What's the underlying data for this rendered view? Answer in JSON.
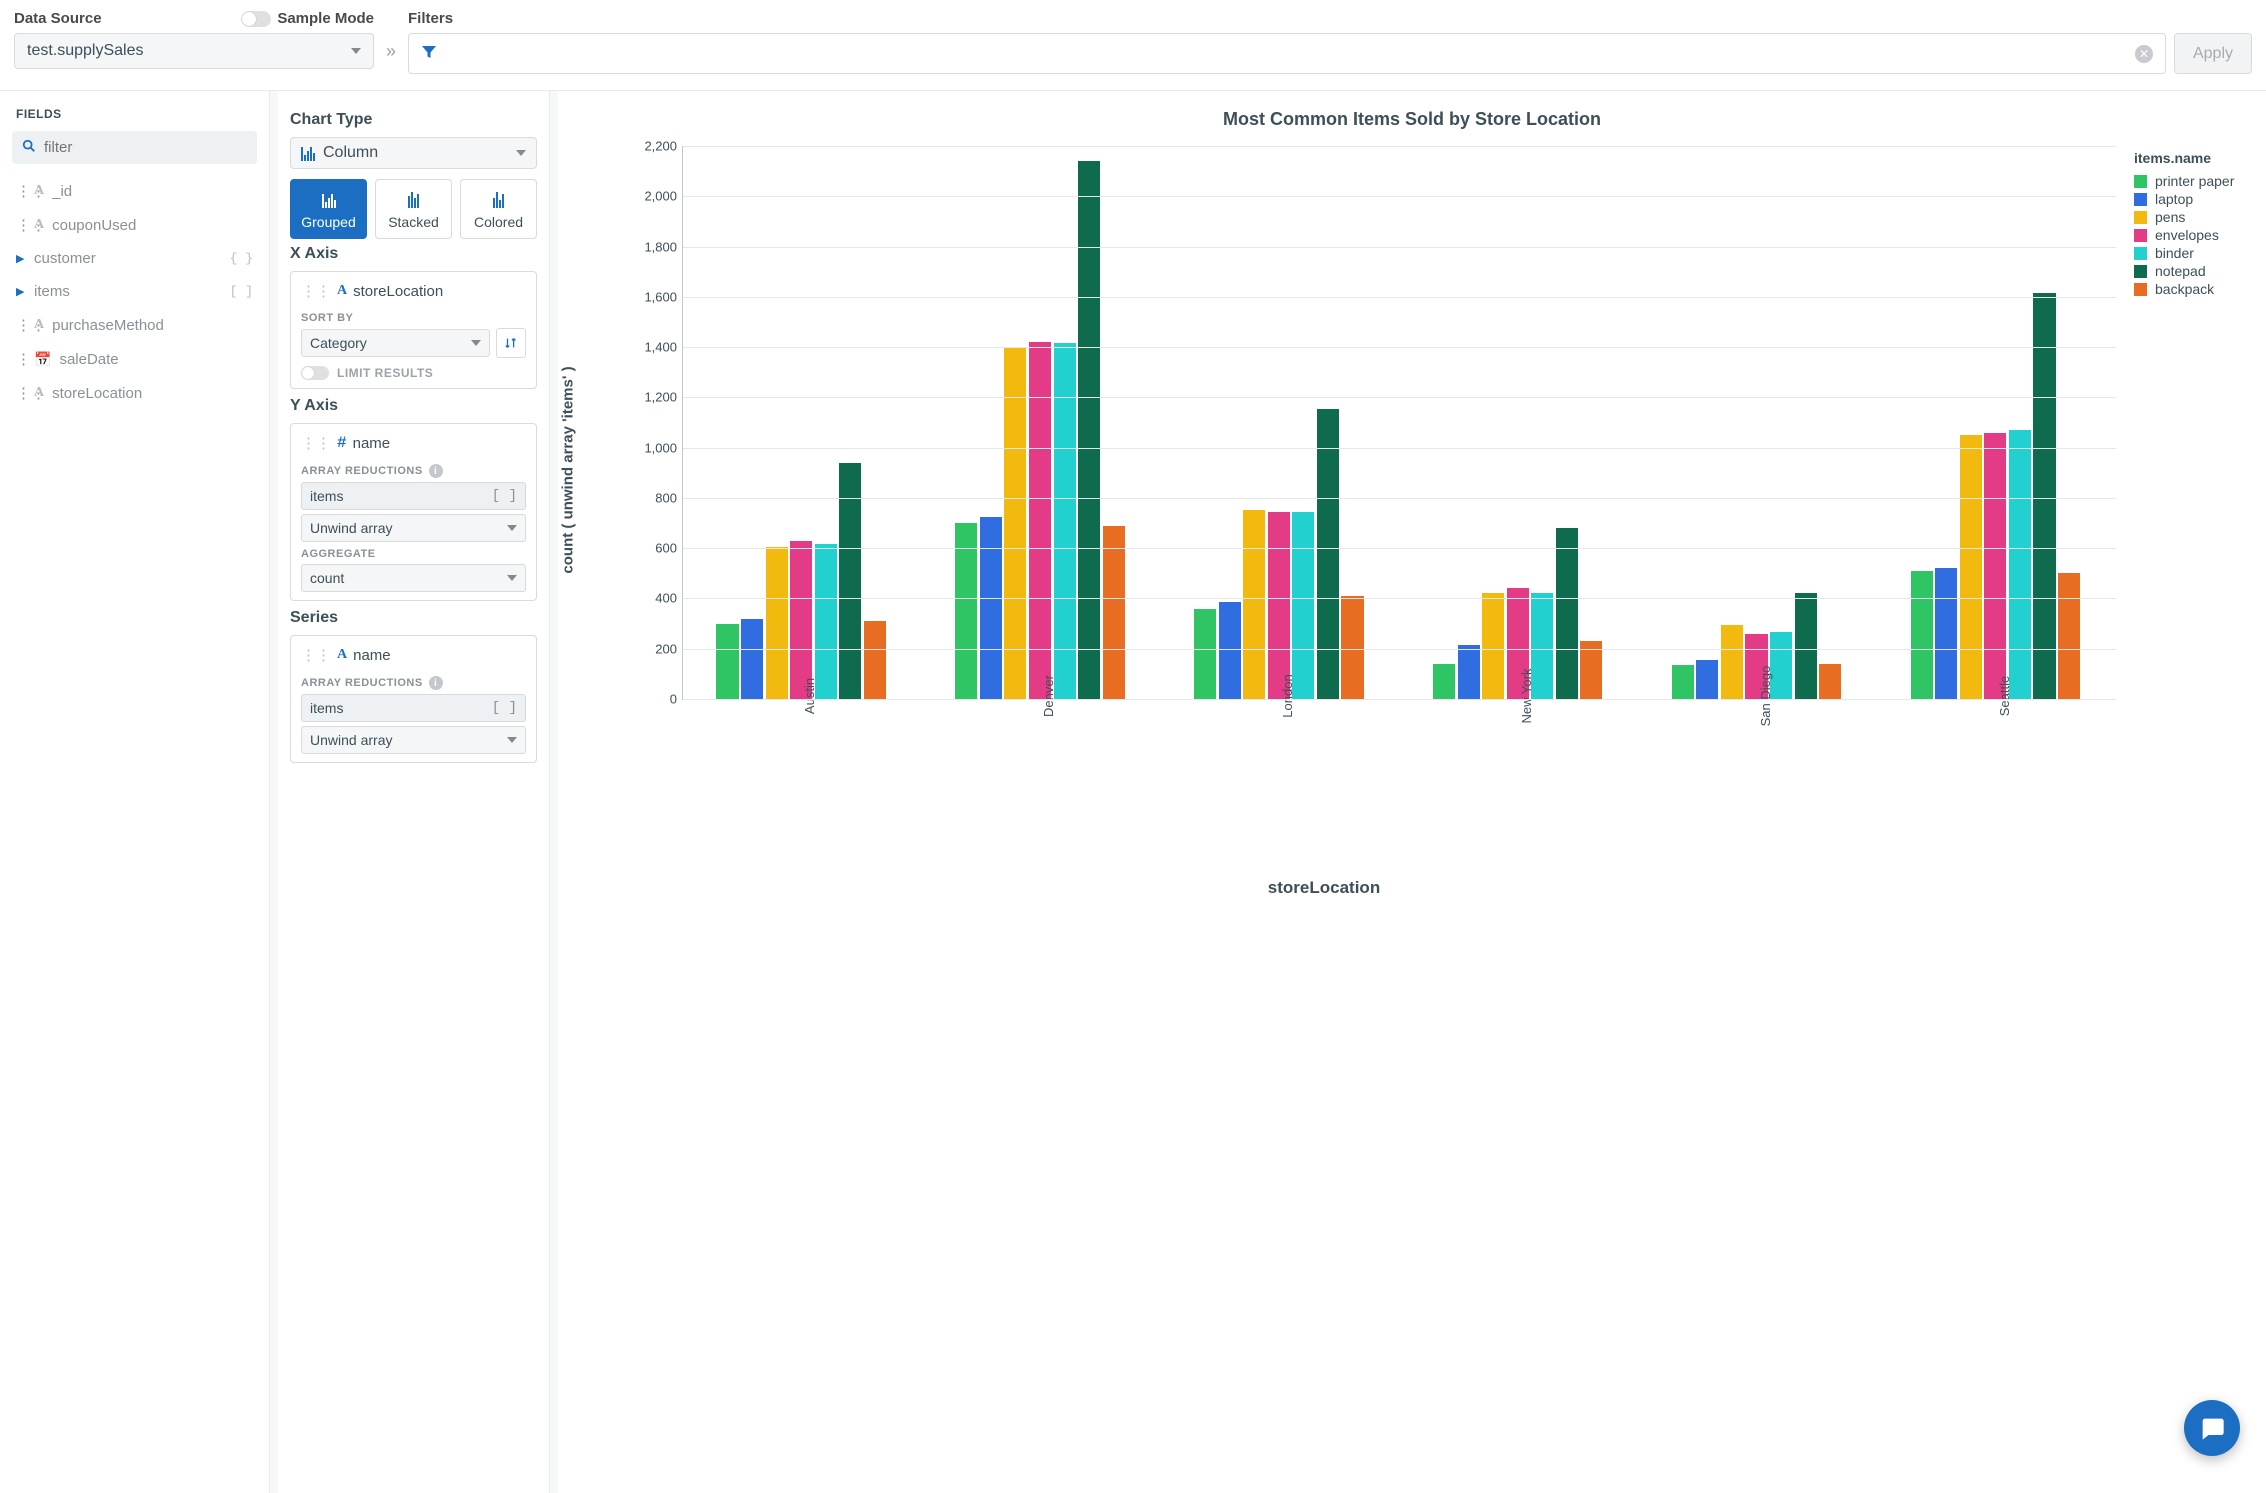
{
  "top": {
    "ds_label": "Data Source",
    "ds_value": "test.supplySales",
    "sample_label": "Sample Mode",
    "filters_label": "Filters",
    "apply": "Apply"
  },
  "fields": {
    "header": "FIELDS",
    "placeholder": "filter",
    "items": [
      {
        "name": "_id",
        "type": "A",
        "expand": false
      },
      {
        "name": "couponUsed",
        "type": "A",
        "expand": false
      },
      {
        "name": "customer",
        "type": "",
        "expand": true,
        "suffix": "{ }"
      },
      {
        "name": "items",
        "type": "",
        "expand": true,
        "suffix": "[ ]"
      },
      {
        "name": "purchaseMethod",
        "type": "A",
        "expand": false
      },
      {
        "name": "saleDate",
        "type": "date",
        "expand": false
      },
      {
        "name": "storeLocation",
        "type": "A",
        "expand": false
      }
    ]
  },
  "config": {
    "chart_type_label": "Chart Type",
    "chart_type": "Column",
    "subtypes": [
      "Grouped",
      "Stacked",
      "Colored"
    ],
    "x": {
      "title": "X Axis",
      "field": "storeLocation",
      "sort_label": "SORT BY",
      "sort_value": "Category",
      "limit_label": "LIMIT RESULTS"
    },
    "y": {
      "title": "Y Axis",
      "field": "name",
      "arr_label": "ARRAY REDUCTIONS",
      "arr_field": "items",
      "arr_op": "Unwind array",
      "agg_label": "AGGREGATE",
      "agg_value": "count"
    },
    "series": {
      "title": "Series",
      "field": "name",
      "arr_label": "ARRAY REDUCTIONS",
      "arr_field": "items",
      "arr_op": "Unwind array"
    }
  },
  "chart_data": {
    "type": "bar",
    "title": "Most Common Items Sold by Store Location",
    "xlabel": "storeLocation",
    "ylabel": "count ( unwind array 'items' )",
    "ylim": [
      0,
      2200
    ],
    "yticks": [
      0,
      200,
      400,
      600,
      800,
      1000,
      1200,
      1400,
      1600,
      1800,
      2000,
      2200
    ],
    "categories": [
      "Austin",
      "Denver",
      "London",
      "New York",
      "San Diego",
      "Seattle"
    ],
    "legend_title": "items.name",
    "series": [
      {
        "name": "printer paper",
        "color": "#2fc464",
        "values": [
          300,
          700,
          360,
          140,
          135,
          510
        ]
      },
      {
        "name": "laptop",
        "color": "#2f6de0",
        "values": [
          320,
          725,
          385,
          215,
          155,
          520
        ]
      },
      {
        "name": "pens",
        "color": "#f2b90e",
        "values": [
          605,
          1400,
          750,
          420,
          295,
          1050
        ]
      },
      {
        "name": "envelopes",
        "color": "#e43b86",
        "values": [
          630,
          1420,
          745,
          440,
          260,
          1060
        ]
      },
      {
        "name": "binder",
        "color": "#22d0d0",
        "values": [
          617,
          1415,
          745,
          420,
          265,
          1070
        ]
      },
      {
        "name": "notepad",
        "color": "#0f6b4d",
        "values": [
          940,
          2140,
          1155,
          680,
          420,
          1615
        ]
      },
      {
        "name": "backpack",
        "color": "#e86c22",
        "values": [
          310,
          690,
          410,
          230,
          140,
          500
        ]
      }
    ]
  }
}
